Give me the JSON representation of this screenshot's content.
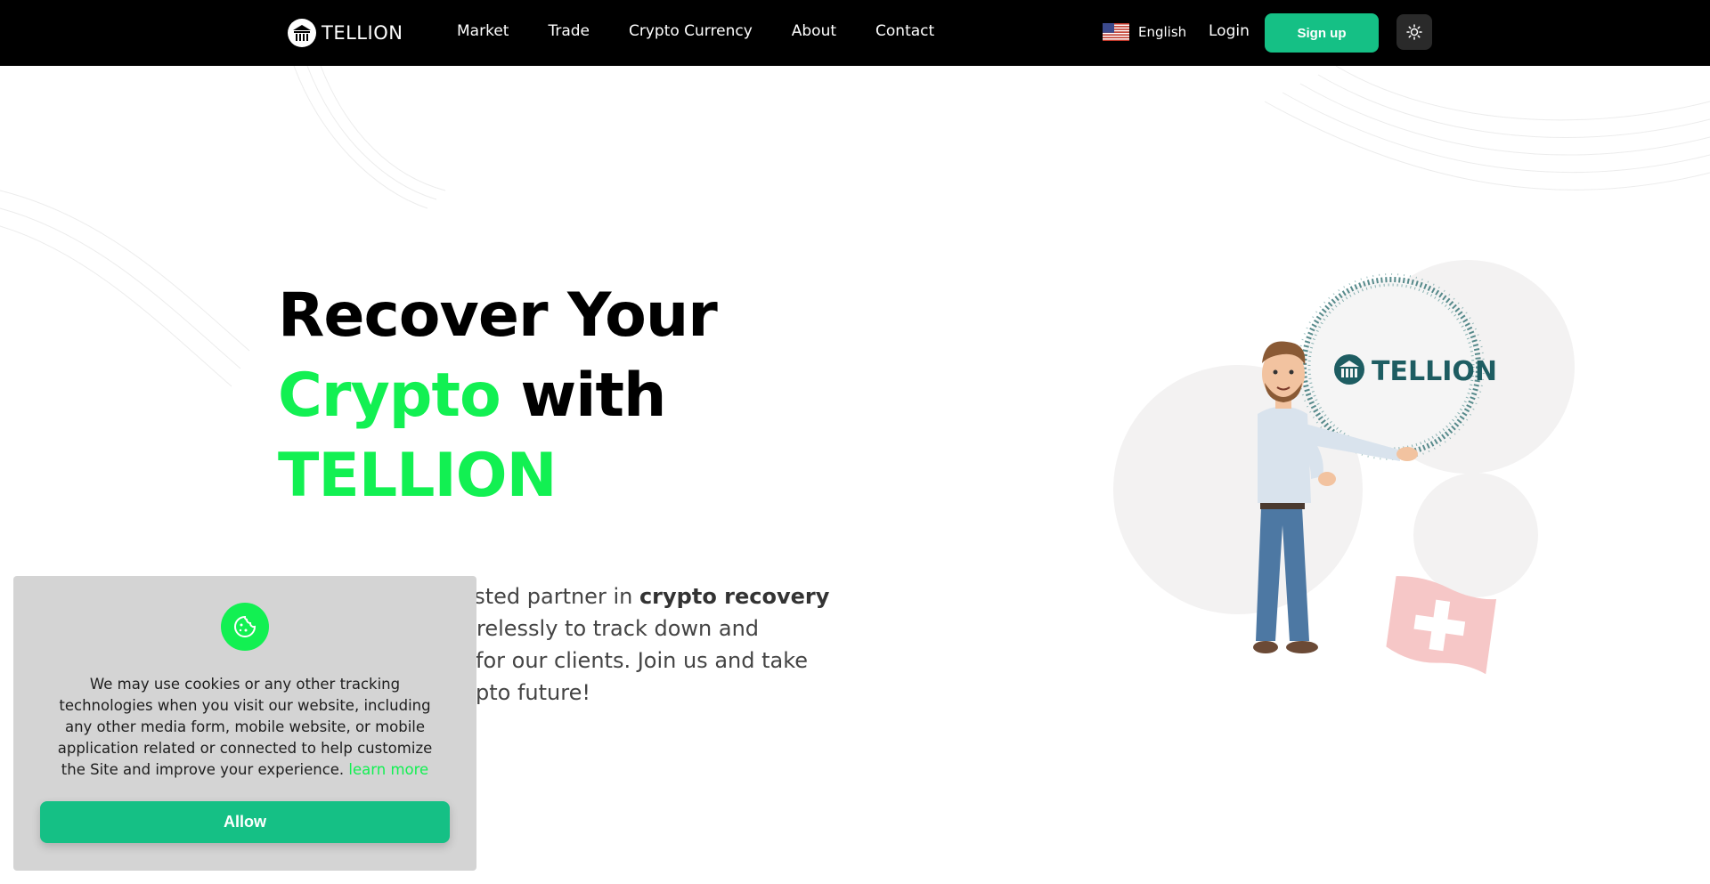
{
  "colors": {
    "accent_green": "#12f052",
    "button_green": "#15c085",
    "navbar_bg": "#000000"
  },
  "nav": {
    "brand": "TELLION",
    "links": [
      "Market",
      "Trade",
      "Crypto Currency",
      "About",
      "Contact"
    ],
    "language": "English",
    "language_flag": "us-flag-icon",
    "login": "Login",
    "signup": "Sign up",
    "theme_icon": "sun-icon"
  },
  "hero": {
    "title_line1": "Recover Your",
    "title_line2_accent": "Crypto",
    "title_line2_rest": " with",
    "title_line3": "TELLION",
    "desc_part1": "usted partner in ",
    "desc_bold": "crypto recovery",
    "desc_part2": "relessly to track down and",
    "desc_part3": "for our clients. Join us and take",
    "desc_part4": "pto future!",
    "illustration_logo": "TELLION"
  },
  "cookie": {
    "icon": "cookie-icon",
    "text": "We may use cookies or any other tracking technologies when you visit our website, including any other media form, mobile website, or mobile application related or connected to help customize the Site and improve your experience.",
    "learn_more": "learn more",
    "allow": "Allow"
  }
}
